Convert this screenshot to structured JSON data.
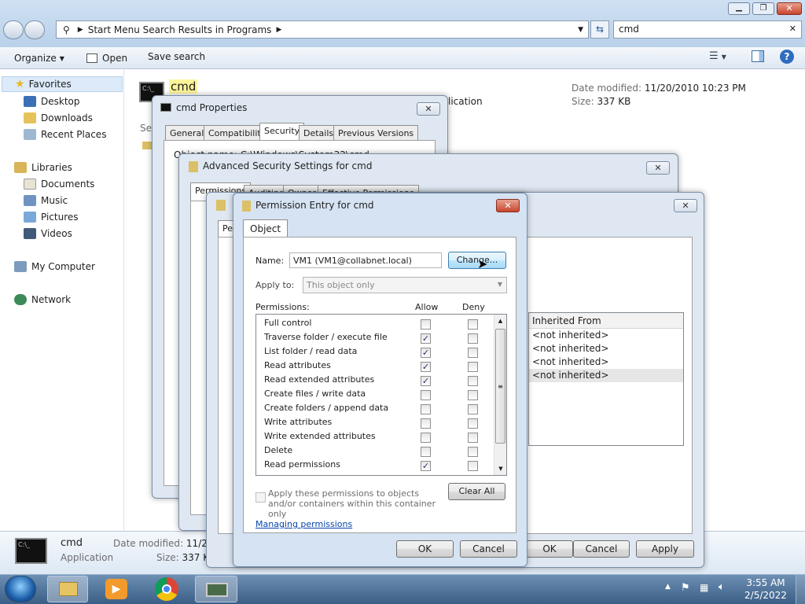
{
  "explorer": {
    "address": "Start Menu Search Results in Programs",
    "search_value": "cmd",
    "toolbar": {
      "organize": "Organize",
      "open": "Open",
      "save_search": "Save search"
    },
    "sidebar": {
      "favorites": "Favorites",
      "fav_items": [
        "Desktop",
        "Downloads",
        "Recent Places"
      ],
      "libraries": "Libraries",
      "lib_items": [
        "Documents",
        "Music",
        "Pictures",
        "Videos"
      ],
      "computer": "My Computer",
      "network": "Network"
    },
    "result": {
      "name": "cmd",
      "type": "Application",
      "date_label": "Date modified:",
      "date_value": "11/20/2010 10:23 PM",
      "size_label": "Size:",
      "size_value": "337 KB",
      "search_again": "Sea"
    },
    "details": {
      "name": "cmd",
      "type": "Application",
      "date_label": "Date modified:",
      "date_value": "11/20/",
      "size_label": "Size:",
      "size_value": "337 KB"
    }
  },
  "cmd_props": {
    "title": "cmd Properties",
    "tabs": [
      "General",
      "Compatibility",
      "Security",
      "Details",
      "Previous Versions"
    ],
    "object_text": "Object name:   C:\\Windows\\System32\\cmd"
  },
  "advanced": {
    "title": "Advanced Security Settings for cmd",
    "tabs": [
      "Permissions",
      "Auditing",
      "Owner",
      "Effective Permissions"
    ]
  },
  "adv2": {
    "tab": "Pe",
    "header_inherited": "Inherited From",
    "inherited_rows": [
      "<not inherited>",
      "<not inherited>",
      "<not inherited>",
      "<not inherited>"
    ],
    "ok": "OK",
    "cancel": "Cancel",
    "apply": "Apply"
  },
  "perm_entry": {
    "title": "Permission Entry for cmd",
    "tab": "Object",
    "name_label": "Name:",
    "name_value": "VM1 (VM1@collabnet.local)",
    "change": "Change...",
    "apply_to_label": "Apply to:",
    "apply_to_value": "This object only",
    "permissions_label": "Permissions:",
    "allow": "Allow",
    "deny": "Deny",
    "permissions": [
      {
        "name": "Full control",
        "allow": false
      },
      {
        "name": "Traverse folder / execute file",
        "allow": true
      },
      {
        "name": "List folder / read data",
        "allow": true
      },
      {
        "name": "Read attributes",
        "allow": true
      },
      {
        "name": "Read extended attributes",
        "allow": true
      },
      {
        "name": "Create files / write data",
        "allow": false
      },
      {
        "name": "Create folders / append data",
        "allow": false
      },
      {
        "name": "Write attributes",
        "allow": false
      },
      {
        "name": "Write extended attributes",
        "allow": false
      },
      {
        "name": "Delete",
        "allow": false
      },
      {
        "name": "Read permissions",
        "allow": true
      }
    ],
    "apply_within": "Apply these permissions to objects and/or containers within this container only",
    "clear_all": "Clear All",
    "managing_link": "Managing permissions",
    "ok": "OK",
    "cancel": "Cancel"
  },
  "taskbar": {
    "time": "3:55 AM",
    "date": "2/5/2022"
  }
}
